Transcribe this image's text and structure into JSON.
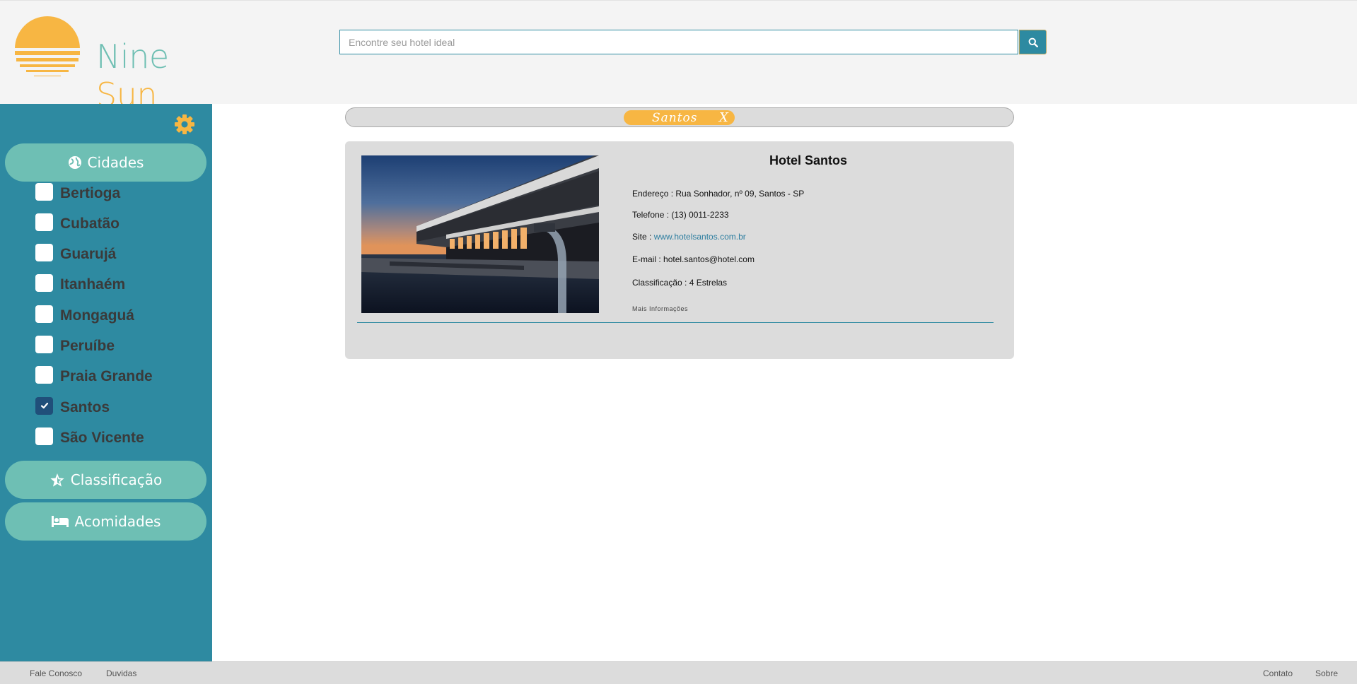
{
  "brand": {
    "word1": "Nine",
    "word2": "Sun"
  },
  "search": {
    "placeholder": "Encontre seu hotel ideal",
    "value": ""
  },
  "sidebar": {
    "sections": {
      "cities": "Cidades",
      "rating": "Classificação",
      "amenities": "Acomidades"
    },
    "cities": [
      {
        "label": "Bertioga",
        "checked": false
      },
      {
        "label": "Cubatão",
        "checked": false
      },
      {
        "label": "Guarujá",
        "checked": false
      },
      {
        "label": "Itanhaém",
        "checked": false
      },
      {
        "label": "Mongaguá",
        "checked": false
      },
      {
        "label": "Peruíbe",
        "checked": false
      },
      {
        "label": "Praia Grande",
        "checked": false
      },
      {
        "label": "Santos",
        "checked": true
      },
      {
        "label": "São Vicente",
        "checked": false
      }
    ]
  },
  "filter_tag": {
    "label": "Santos",
    "remove": "X"
  },
  "hotel": {
    "name": "Hotel Santos",
    "address_label": "Endereço : ",
    "address": "Rua Sonhador, nº 09, Santos - SP",
    "phone_label": "Telefone : ",
    "phone": "(13) 0011-2233",
    "site_label": "Site : ",
    "site": "www.hotelsantos.com.br",
    "email_label": "E-mail : ",
    "email": "hotel.santos@hotel.com",
    "rating_label": "Classificação : ",
    "rating": "4 Estrelas",
    "more": "Mais Informações"
  },
  "footer": {
    "left": [
      "Fale Conosco",
      "Duvidas"
    ],
    "right": [
      "Contato",
      "Sobre"
    ]
  },
  "colors": {
    "teal": "#2e8aa1",
    "mint": "#6ebfb4",
    "orange": "#f7b643",
    "panel": "#dcdcdc"
  }
}
